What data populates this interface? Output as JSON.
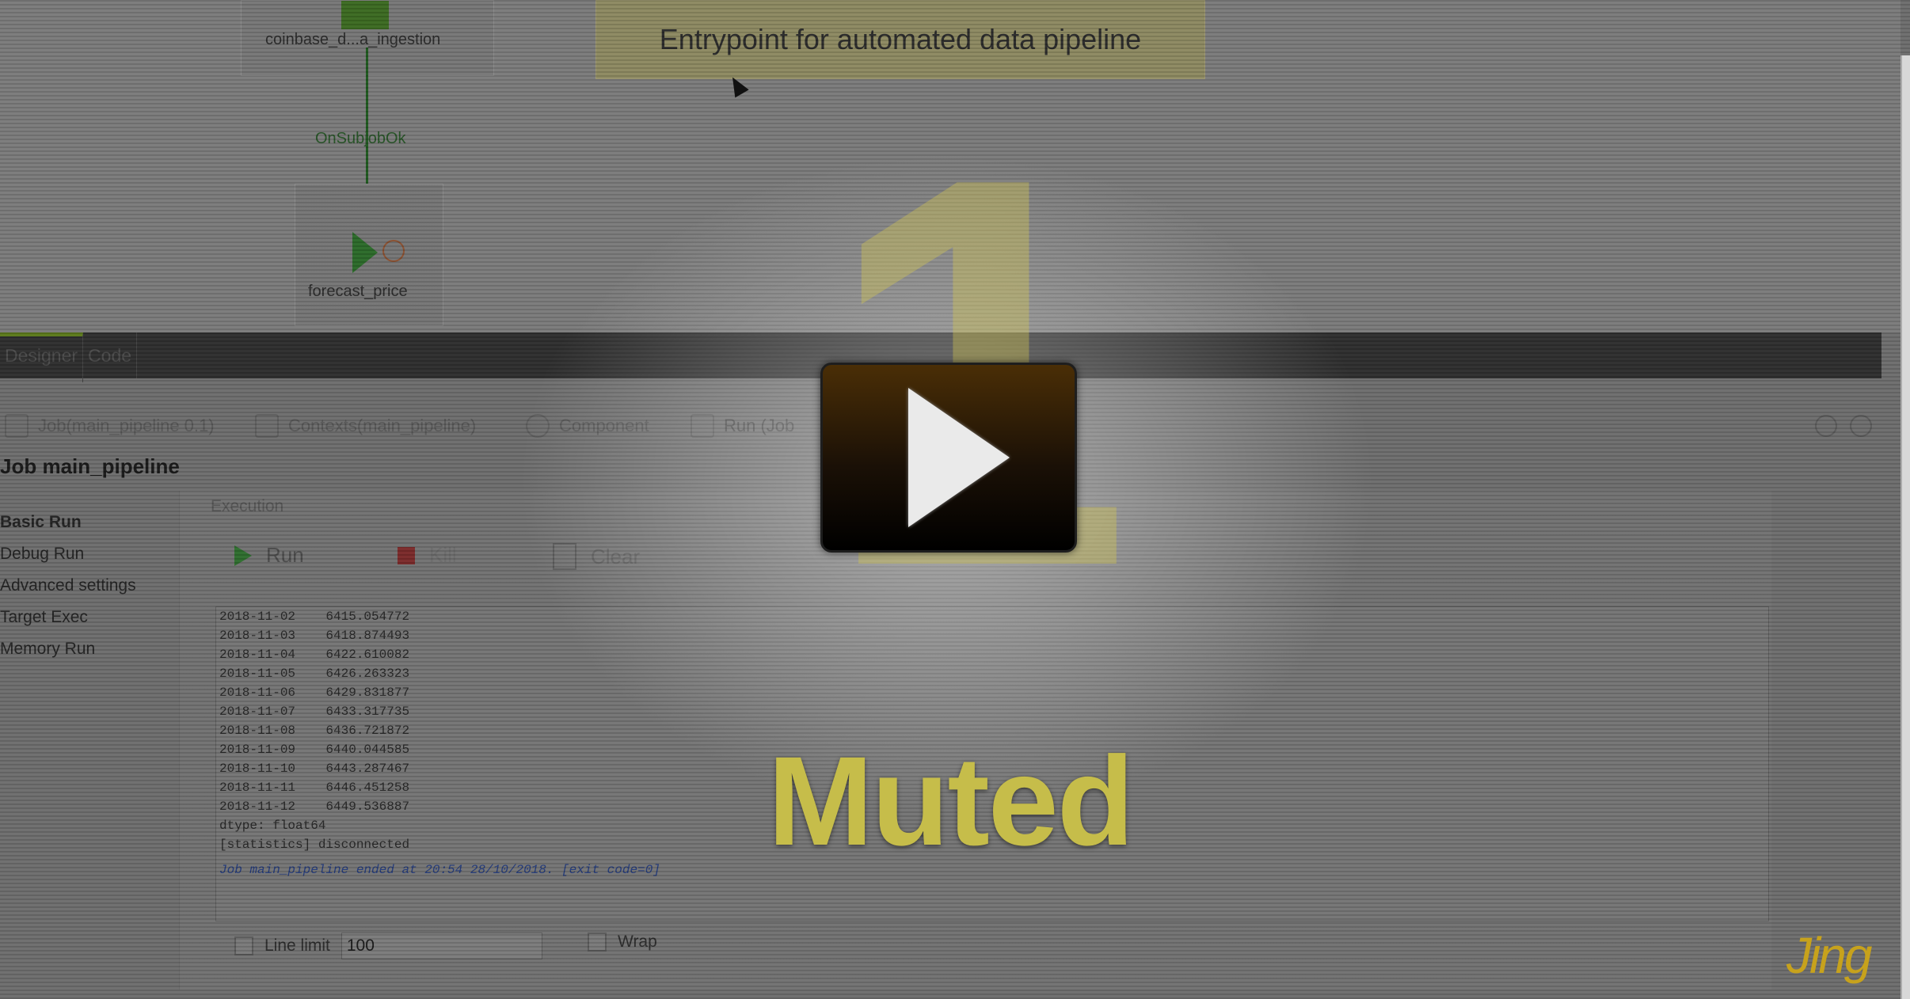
{
  "designer": {
    "nodes": [
      {
        "name": "coinbase_data_ingestion",
        "label": "coinbase_d...a_ingestion"
      },
      {
        "name": "forecast_price",
        "label": "forecast_price"
      }
    ],
    "connector_label": "OnSubjobOk",
    "note_text": "Entrypoint for automated data pipeline"
  },
  "editor_tabs": [
    "Designer",
    "Code"
  ],
  "view_tabs": [
    {
      "label": "Job(main_pipeline 0.1)",
      "icon": "job-icon"
    },
    {
      "label": "Contexts(main_pipeline)",
      "icon": "contexts-icon"
    },
    {
      "label": "Component",
      "icon": "component-icon"
    },
    {
      "label": "Run (Job",
      "icon": "run-icon"
    }
  ],
  "job_title": "Job main_pipeline",
  "run_modes": [
    "Basic Run",
    "Debug Run",
    "Advanced settings",
    "Target Exec",
    "Memory Run"
  ],
  "execution": {
    "section_label": "Execution",
    "run_label": "Run",
    "kill_label": "Kill",
    "clear_label": "Clear"
  },
  "console_lines": [
    "2018-11-02    6415.054772",
    "2018-11-03    6418.874493",
    "2018-11-04    6422.610082",
    "2018-11-05    6426.263323",
    "2018-11-06    6429.831877",
    "2018-11-07    6433.317735",
    "2018-11-08    6436.721872",
    "2018-11-09    6440.044585",
    "2018-11-10    6443.287467",
    "2018-11-11    6446.451258",
    "2018-11-12    6449.536887",
    "dtype: float64",
    "[statistics] disconnected"
  ],
  "console_exit": "Job main_pipeline ended at 20:54 28/10/2018. [exit code=0]",
  "options": {
    "line_limit_label": "Line limit",
    "line_limit_value": "100",
    "wrap_label": "Wrap"
  },
  "overlay": {
    "countdown": "1",
    "status": "Muted",
    "brand": "Jing"
  }
}
